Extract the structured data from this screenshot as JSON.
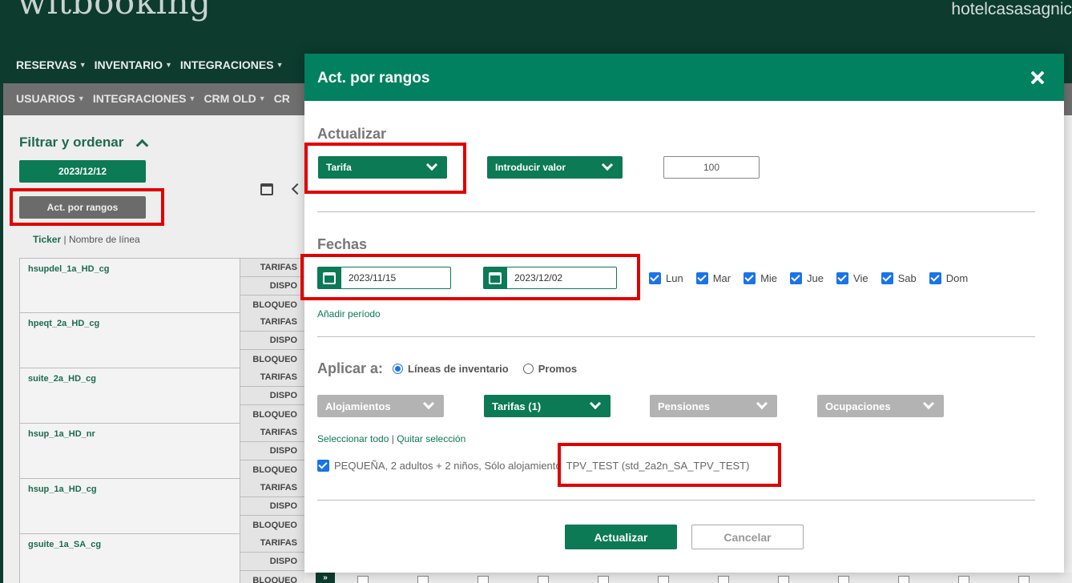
{
  "app": {
    "logo": "witbooking",
    "hotel": "hotelcasasagnic"
  },
  "nav_primary": [
    "RESERVAS",
    "INVENTARIO",
    "INTEGRACIONES"
  ],
  "nav_secondary": [
    "USUARIOS",
    "INTEGRACIONES",
    "CRM OLD",
    "CR"
  ],
  "sidebar": {
    "filter_title": "Filtrar y ordenar",
    "date_button": "2023/12/12",
    "range_button": "Act. por rangos",
    "ticker": "Ticker",
    "separator": "|",
    "line_name": "Nombre de línea"
  },
  "inventory": [
    {
      "name": "hsupdel_1a_HD_cg",
      "rows": [
        "TARIFAS",
        "DISPO",
        "BLOQUEO"
      ]
    },
    {
      "name": "hpeqt_2a_HD_cg",
      "rows": [
        "TARIFAS",
        "DISPO",
        "BLOQUEO"
      ]
    },
    {
      "name": "suite_2a_HD_cg",
      "rows": [
        "TARIFAS",
        "DISPO",
        "BLOQUEO"
      ]
    },
    {
      "name": "hsup_1a_HD_nr",
      "rows": [
        "TARIFAS",
        "DISPO",
        "BLOQUEO"
      ]
    },
    {
      "name": "hsup_1a_HD_cg",
      "rows": [
        "TARIFAS",
        "DISPO",
        "BLOQUEO"
      ]
    },
    {
      "name": "gsuite_1a_SA_cg",
      "rows": [
        "TARIFAS",
        "DISPO",
        "BLOQUEO"
      ]
    }
  ],
  "bottom_strip": {
    "arrow": "»"
  },
  "modal": {
    "title": "Act. por rangos",
    "update_section": {
      "title": "Actualizar",
      "field_select": "Tarifa",
      "mode_select": "Introducir valor",
      "value": "100"
    },
    "dates_section": {
      "title": "Fechas",
      "from": "2023/11/15",
      "to": "2023/12/02",
      "days": [
        {
          "label": "Lun",
          "checked": true
        },
        {
          "label": "Mar",
          "checked": true
        },
        {
          "label": "Mie",
          "checked": true
        },
        {
          "label": "Jue",
          "checked": true
        },
        {
          "label": "Vie",
          "checked": true
        },
        {
          "label": "Sab",
          "checked": true
        },
        {
          "label": "Dom",
          "checked": true
        }
      ],
      "add_period": "Añadir período"
    },
    "apply_section": {
      "title": "Aplicar a:",
      "option_lines": "Líneas de inventario",
      "option_promos": "Promos",
      "selected": "Líneas de inventario",
      "filters": [
        "Alojamientos",
        "Tarifas (1)",
        "Pensiones",
        "Ocupaciones"
      ],
      "select_all": "Seleccionar todo",
      "separator": "|",
      "clear_selection": "Quitar selección",
      "line_item": {
        "checked": true,
        "label": "PEQUEÑA, 2 adultos + 2 niños, Sólo alojamiento",
        "rate": "TPV_TEST (std_2a2n_SA_TPV_TEST)"
      }
    },
    "buttons": {
      "submit": "Actualizar",
      "cancel": "Cancelar"
    }
  },
  "colors": {
    "header": "#018160",
    "primary": "#0b7a55",
    "topbar": "#0d3b2e",
    "annotation": "#e00000",
    "checkbox": "#1a73e8"
  }
}
